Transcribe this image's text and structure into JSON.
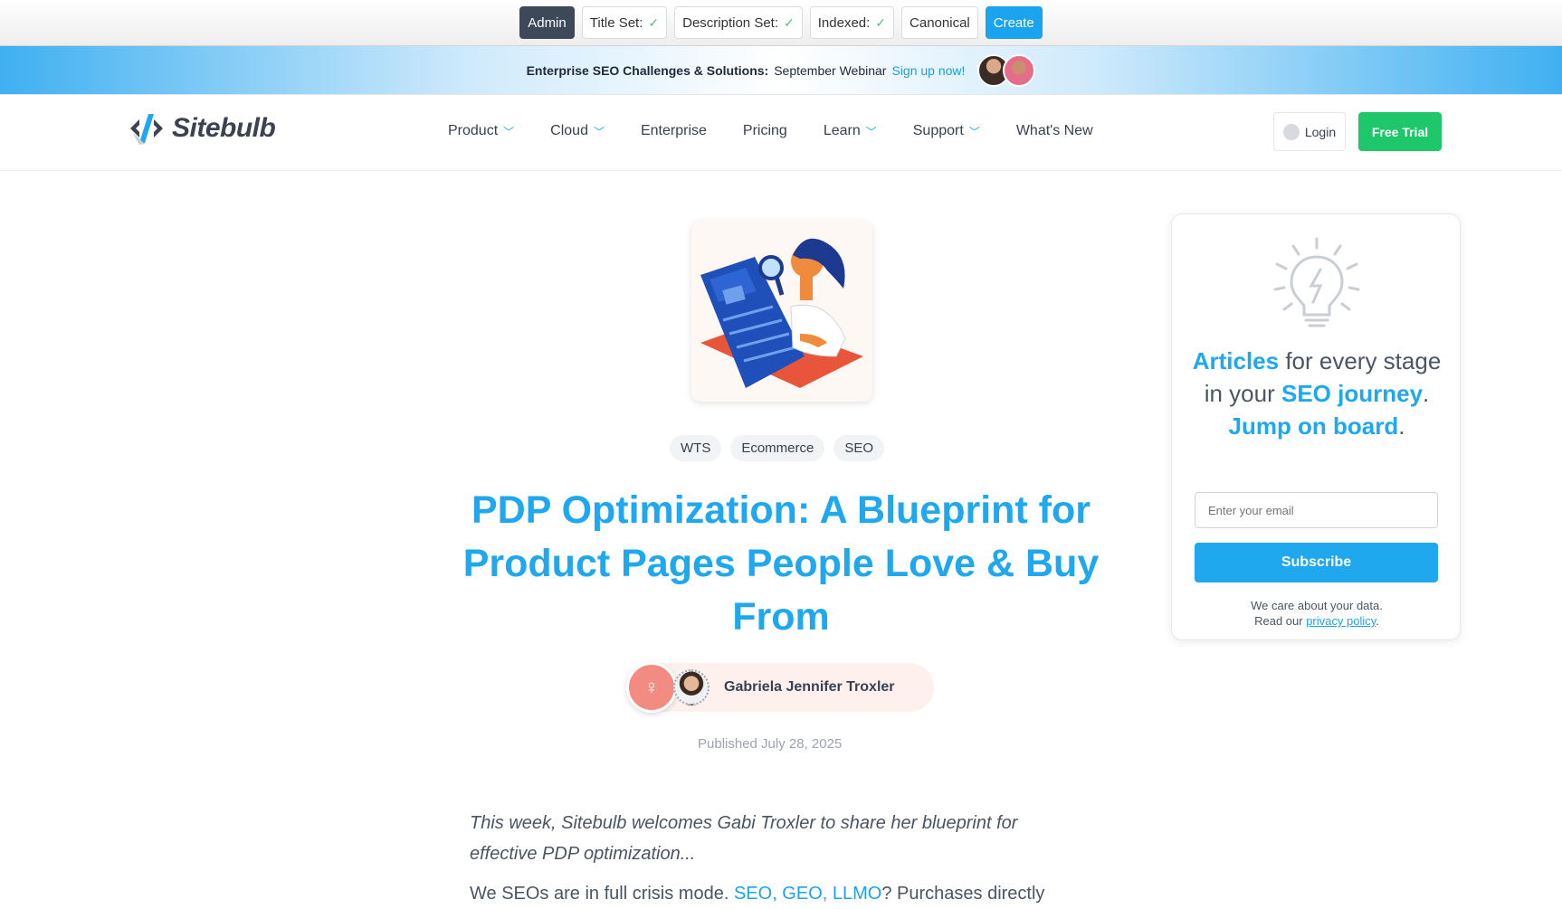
{
  "admin_bar": {
    "admin": "Admin",
    "title_set": "Title Set:",
    "description_set": "Description Set:",
    "indexed": "Indexed:",
    "check": "✓",
    "canonical": "Canonical",
    "create": "Create"
  },
  "webinar": {
    "bold": "Enterprise SEO Challenges & Solutions:",
    "text": "September Webinar",
    "link": "Sign up now!"
  },
  "header": {
    "logo": "Sitebulb",
    "nav": [
      {
        "label": "Product",
        "dropdown": true
      },
      {
        "label": "Cloud",
        "dropdown": true
      },
      {
        "label": "Enterprise",
        "dropdown": false
      },
      {
        "label": "Pricing",
        "dropdown": false
      },
      {
        "label": "Learn",
        "dropdown": true
      },
      {
        "label": "Support",
        "dropdown": true
      },
      {
        "label": "What's New",
        "dropdown": false
      }
    ],
    "login": "Login",
    "free_trial": "Free Trial"
  },
  "article": {
    "tags": [
      "WTS",
      "Ecommerce",
      "SEO"
    ],
    "title": "PDP Optimization: A Blueprint for Product Pages People Love & Buy From",
    "author": "Gabriela Jennifer Troxler",
    "published": "Published July 28, 2025",
    "intro": "This week, Sitebulb welcomes Gabi Troxler to share her blueprint for effective PDP optimization...",
    "para_start": "We SEOs are in full crisis mode.",
    "para_link": "SEO, GEO, LLMO",
    "para_end": "? Purchases directly"
  },
  "sidebar": {
    "promo": {
      "w1": "Articles",
      "w2": " for every stage in your ",
      "w3": "SEO journey",
      "w4": ". ",
      "w5": "Jump on board",
      "w6": "."
    },
    "email_placeholder": "Enter your email",
    "subscribe": "Subscribe",
    "care_line1": "We care about your data.",
    "care_line2": "Read our",
    "privacy": "privacy policy",
    "period": "."
  },
  "colors": {
    "brand_blue": "#1fa8ee",
    "trial_green": "#1ec86a",
    "admin_dark": "#3d4858"
  }
}
